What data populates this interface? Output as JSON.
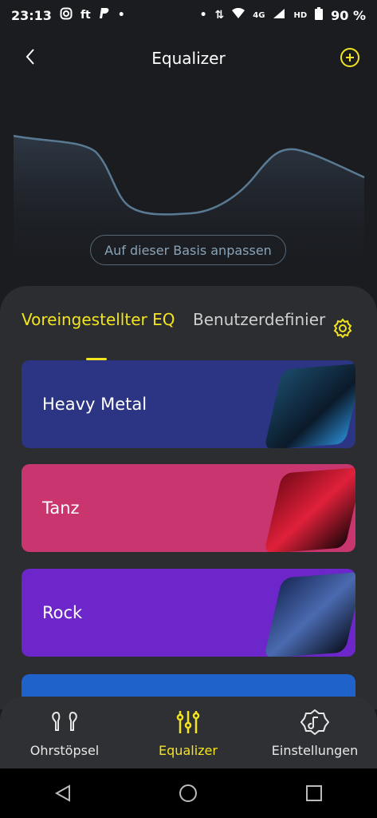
{
  "status": {
    "time": "23:13",
    "left_icons": [
      "instagram-icon",
      "ft-text",
      "paypal-icon",
      "dot"
    ],
    "ft": "ft",
    "network": "4G",
    "hd": "HD",
    "battery": "90 %"
  },
  "header": {
    "title": "Equalizer"
  },
  "curve": {
    "button_label": "Auf dieser Basis anpassen"
  },
  "tabs": [
    {
      "label": "Voreingestellter EQ",
      "active": true
    },
    {
      "label": "Benutzerdefinier",
      "active": false
    }
  ],
  "presets": [
    {
      "label": "Heavy Metal",
      "color": "#2b3583"
    },
    {
      "label": "Tanz",
      "color": "#c9356e"
    },
    {
      "label": "Rock",
      "color": "#6d26c9"
    },
    {
      "label": "",
      "color": "#1f62c9"
    }
  ],
  "nav": [
    {
      "label": "Ohrstöpsel",
      "icon": "earbuds-icon"
    },
    {
      "label": "Equalizer",
      "icon": "sliders-icon",
      "active": true
    },
    {
      "label": "Einstellungen",
      "icon": "settings-icon"
    }
  ],
  "colors": {
    "accent": "#f3e420",
    "background": "#1a1c20"
  }
}
